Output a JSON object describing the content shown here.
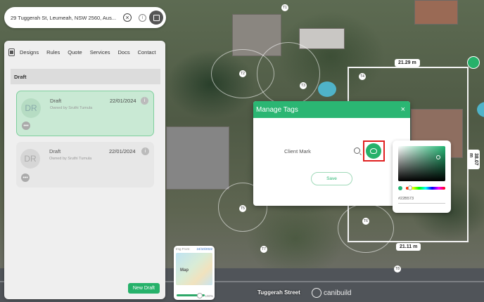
{
  "address": {
    "value": "29 Tuggerah St, Leumeah, NSW 2560, Aus..."
  },
  "nav": {
    "tabs": [
      "Designs",
      "Rules",
      "Quote",
      "Services",
      "Docs",
      "Contact"
    ]
  },
  "drafts": {
    "section_title": "Draft",
    "cards": [
      {
        "avatar": "DR",
        "name": "Draft",
        "owner": "Owned by Sruthi Tumula",
        "date": "22/01/2024",
        "selected": true
      },
      {
        "avatar": "DR",
        "name": "Draft",
        "owner": "Owned by Sruthi Tumula",
        "date": "22/01/2024",
        "selected": false
      }
    ],
    "new_button": "New Draft"
  },
  "map": {
    "dimensions": [
      "21.29 m",
      "21.11 m",
      "38.07 m"
    ],
    "road_name": "Tuggerah Street",
    "brand": "canibuild",
    "marker_labels": [
      "T1",
      "T2",
      "T3",
      "T4",
      "T5",
      "T6",
      "T7",
      "T8"
    ]
  },
  "minimap": {
    "date_label": "Img From:",
    "date": "24/10/2022",
    "map_label": "Map",
    "zoom": "100%"
  },
  "modal": {
    "title": "Manage Tags",
    "tag_name": "Client Mark",
    "save_label": "Save"
  },
  "color_picker": {
    "hex": "#22B573"
  },
  "colors": {
    "accent": "#26b16a",
    "highlight": "#e02020"
  }
}
